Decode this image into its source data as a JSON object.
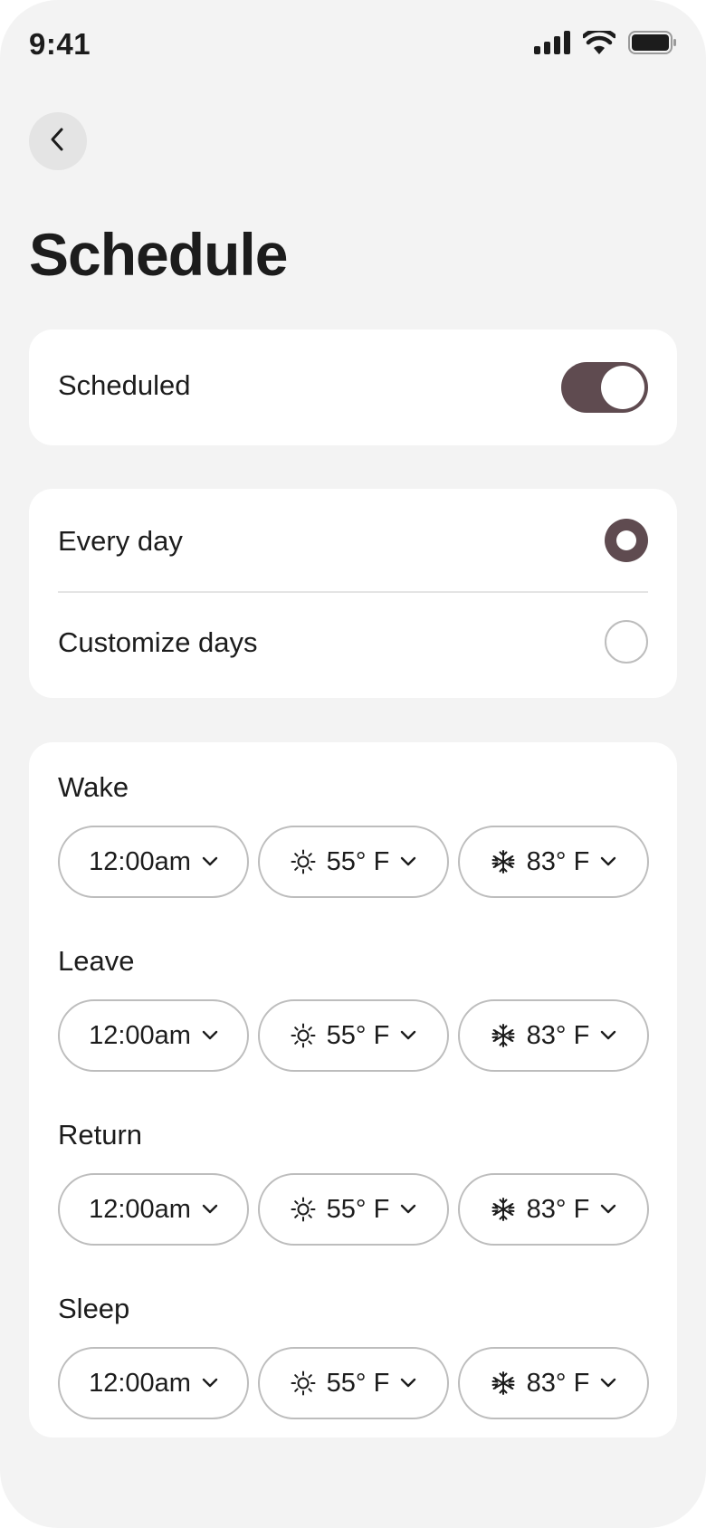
{
  "status": {
    "time": "9:41"
  },
  "header": {
    "title": "Schedule"
  },
  "scheduled": {
    "label": "Scheduled",
    "enabled": true
  },
  "days": {
    "options": [
      {
        "label": "Every day",
        "selected": true
      },
      {
        "label": "Customize days",
        "selected": false
      }
    ]
  },
  "periods": [
    {
      "label": "Wake",
      "time": "12:00am",
      "heat": "55° F",
      "cool": "83° F"
    },
    {
      "label": "Leave",
      "time": "12:00am",
      "heat": "55° F",
      "cool": "83° F"
    },
    {
      "label": "Return",
      "time": "12:00am",
      "heat": "55° F",
      "cool": "83° F"
    },
    {
      "label": "Sleep",
      "time": "12:00am",
      "heat": "55° F",
      "cool": "83° F"
    }
  ],
  "icons": {
    "back": "chevron-left-icon",
    "heat": "sun-icon",
    "cool": "snowflake-icon",
    "dropdown": "chevron-down-icon",
    "signal": "cellular-signal-icon",
    "wifi": "wifi-icon",
    "battery": "battery-icon"
  },
  "colors": {
    "accent": "#5f4b50",
    "background": "#f3f3f3",
    "card": "#ffffff",
    "border": "#bdbdbd"
  }
}
